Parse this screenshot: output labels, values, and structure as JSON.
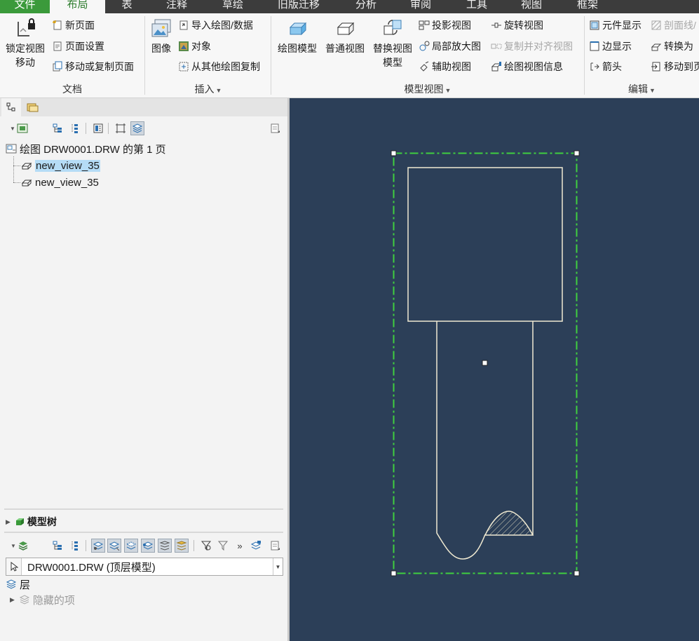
{
  "menu": {
    "tabs": [
      {
        "label": "文件"
      },
      {
        "label": "布局"
      },
      {
        "label": "表"
      },
      {
        "label": "注释"
      },
      {
        "label": "草绘"
      },
      {
        "label": "旧版迁移"
      },
      {
        "label": "分析"
      },
      {
        "label": "审阅"
      },
      {
        "label": "工具"
      },
      {
        "label": "视图"
      },
      {
        "label": "框架"
      }
    ],
    "active_tab": "布局"
  },
  "ribbon": {
    "document": {
      "label": "文档",
      "lock_view_line1": "锁定视图",
      "lock_view_line2": "移动",
      "new_page": "新页面",
      "page_setup": "页面设置",
      "move_copy_page": "移动或复制页面"
    },
    "insert": {
      "label": "插入",
      "image": "图像",
      "import_drawing": "导入绘图/数据",
      "object": "对象",
      "copy_from_other": "从其他绘图复制"
    },
    "model_views": {
      "label": "模型视图",
      "drawing_model": "绘图模型",
      "general_view": "普通视图",
      "replace_view_line1": "替换视图",
      "replace_view_line2": "模型",
      "projection_view": "投影视图",
      "detailed_view": "局部放大图",
      "auxiliary_view": "辅助视图",
      "revolved_view": "旋转视图",
      "copy_align_view": "复制并对齐视图",
      "drawing_view_info": "绘图视图信息"
    },
    "edit": {
      "label": "编辑",
      "component_display": "元件显示",
      "section_line": "剖面线/",
      "edge_display": "边显示",
      "convert_to": "转换为",
      "arrow": "箭头",
      "move_to": "移动到页"
    }
  },
  "left_panel": {
    "tree_root": "绘图 DRW0001.DRW 的第 1 页",
    "tree_items": [
      {
        "label": "new_view_35",
        "selected": true
      },
      {
        "label": "new_view_35",
        "selected": false
      }
    ],
    "model_tree_label": "模型树",
    "model_combo_value": "DRW0001.DRW (顶层模型)",
    "layers_label": "层",
    "hidden_items_label": "隐藏的项"
  },
  "colors": {
    "canvas_bg": "#2c3f58",
    "file_tab": "#3b9a3b",
    "active_tab_text": "#2d7d2d",
    "view_boundary": "#3fcf3f",
    "selection_highlight": "#b5dcf6"
  }
}
